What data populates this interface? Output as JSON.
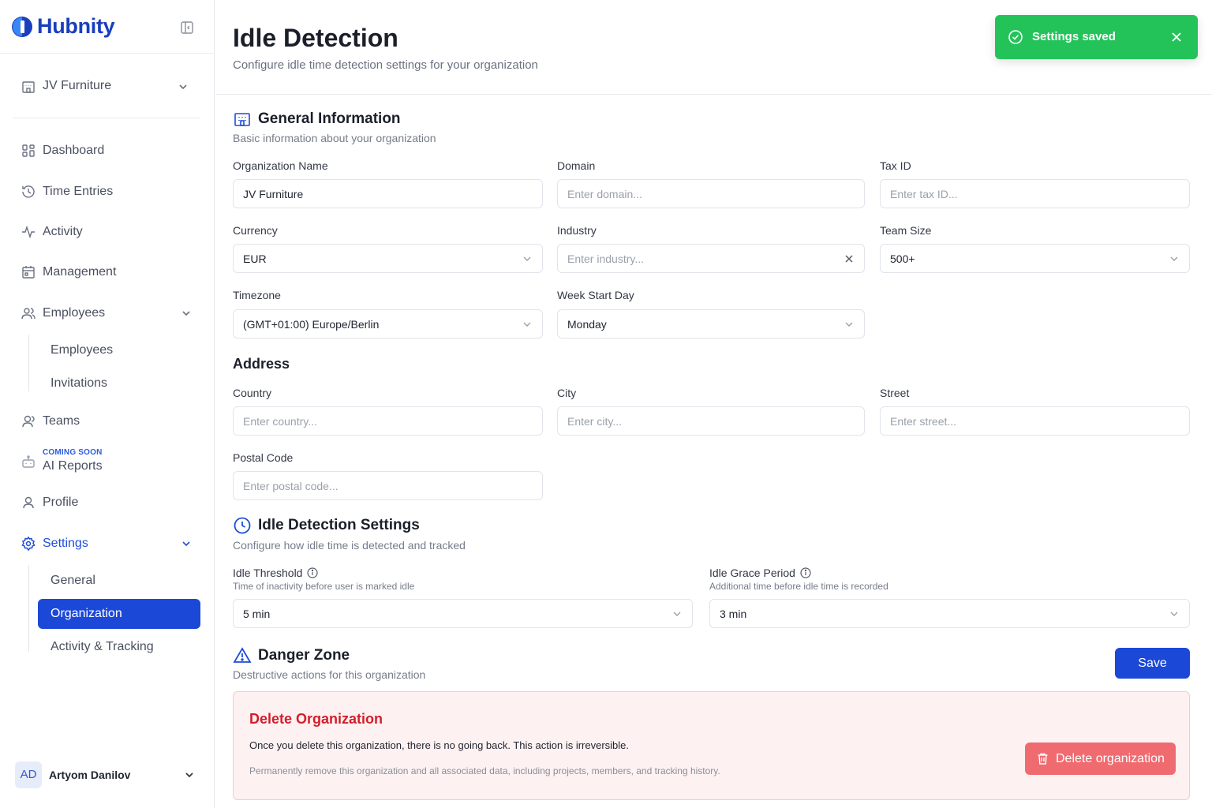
{
  "brand": {
    "name": "Hubnity",
    "accent": "#1c48d8"
  },
  "sidebar": {
    "org_switcher": "JV Furniture",
    "items": {
      "dashboard": "Dashboard",
      "time_entries": "Time Entries",
      "activity": "Activity",
      "management": "Management",
      "employees": "Employees",
      "teams": "Teams",
      "ai_reports": "AI Reports",
      "ai_badge": "COMING SOON",
      "profile": "Profile",
      "settings": "Settings"
    },
    "employees_sub": [
      "Employees",
      "Invitations"
    ],
    "settings_sub": [
      "General",
      "Organization",
      "Activity & Tracking"
    ],
    "selected_sub": "Organization",
    "user": {
      "initials": "AD",
      "name": "Artyom Danilov"
    }
  },
  "header": {
    "title": "Idle Detection",
    "subtitle": "Configure idle time detection settings for your organization"
  },
  "toast": {
    "text": "Settings saved",
    "color": "#24c35a"
  },
  "general": {
    "title": "General Information",
    "subtitle": "Basic information about your organization",
    "org_name": {
      "label": "Organization Name",
      "value": "JV Furniture"
    },
    "domain": {
      "label": "Domain",
      "placeholder": "Enter domain..."
    },
    "tax_id": {
      "label": "Tax ID",
      "placeholder": "Enter tax ID..."
    },
    "currency": {
      "label": "Currency",
      "value": "EUR"
    },
    "industry": {
      "label": "Industry",
      "placeholder": "Enter industry..."
    },
    "team_size": {
      "label": "Team Size",
      "value": "500+"
    },
    "timezone": {
      "label": "Timezone",
      "value": "(GMT+01:00) Europe/Berlin"
    },
    "week_start": {
      "label": "Week Start Day",
      "value": "Monday"
    }
  },
  "address": {
    "title": "Address",
    "country": {
      "label": "Country",
      "placeholder": "Enter country..."
    },
    "city": {
      "label": "City",
      "placeholder": "Enter city..."
    },
    "street": {
      "label": "Street",
      "placeholder": "Enter street..."
    },
    "postal": {
      "label": "Postal Code",
      "placeholder": "Enter postal code..."
    }
  },
  "idle": {
    "title": "Idle Detection Settings",
    "subtitle": "Configure how idle time is detected and tracked",
    "threshold": {
      "label": "Idle Threshold",
      "hint": "Time of inactivity before user is marked idle",
      "value": "5 min"
    },
    "grace": {
      "label": "Idle Grace Period",
      "hint": "Additional time before idle time is recorded",
      "value": "3 min"
    }
  },
  "danger": {
    "title": "Danger Zone",
    "subtitle": "Destructive actions for this organization",
    "box_title": "Delete Organization",
    "warning": "Once you delete this organization, there is no going back. This action is irreversible.",
    "detail": "Permanently remove this organization and all associated data, including projects, members, and tracking history.",
    "delete_label": "Delete organization",
    "color": "#d21e2b"
  },
  "actions": {
    "save_label": "Save"
  }
}
